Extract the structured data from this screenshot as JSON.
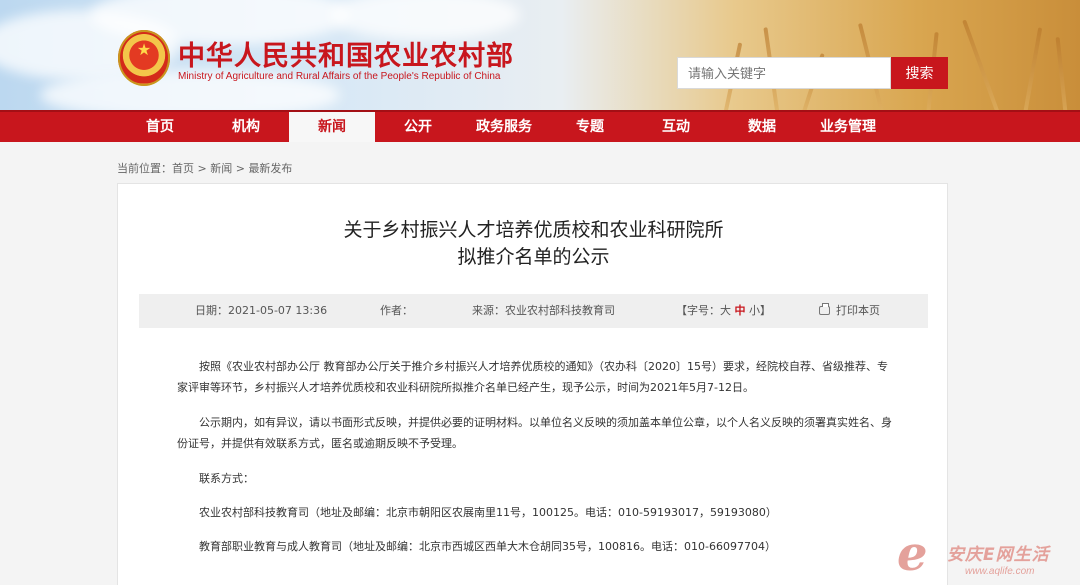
{
  "header": {
    "title": "中华人民共和国农业农村部",
    "subtitle": "Ministry of Agriculture and Rural Affairs of the People's Republic of China",
    "search_placeholder": "请输入关键字",
    "search_button": "搜索"
  },
  "nav": {
    "items": [
      "首页",
      "机构",
      "新闻",
      "公开",
      "政务服务",
      "专题",
      "互动",
      "数据",
      "业务管理"
    ],
    "active": "新闻"
  },
  "breadcrumb": {
    "label": "当前位置：",
    "items": [
      "首页",
      "新闻",
      "最新发布"
    ],
    "separator": ">"
  },
  "article": {
    "title_line1": "关于乡村振兴人才培养优质校和农业科研院所",
    "title_line2": "拟推介名单的公示",
    "meta": {
      "date": "日期：2021-05-07 13:36",
      "author": "作者：",
      "source": "来源：农业农村部科技教育司",
      "font_label": "【字号：",
      "font_large": "大",
      "font_medium": "中",
      "font_small": "小",
      "font_end": "】",
      "print": "打印本页"
    },
    "para1": "按照《农业农村部办公厅 教育部办公厅关于推介乡村振兴人才培养优质校的通知》（农办科〔2020〕15号）要求，经院校自荐、省级推荐、专家评审等环节，乡村振兴人才培养优质校和农业科研院所拟推介名单已经产生，现予公示，时间为2021年5月7-12日。",
    "para2": "公示期内，如有异议，请以书面形式反映，并提供必要的证明材料。以单位名义反映的须加盖本单位公章，以个人名义反映的须署真实姓名、身份证号，并提供有效联系方式，匿名或逾期反映不予受理。",
    "contact_label": "联系方式：",
    "contact1": "农业农村部科技教育司（地址及邮编：北京市朝阳区农展南里11号，100125。电话：010-59193017，59193080）",
    "contact2": "教育部职业教育与成人教育司（地址及邮编：北京市西城区西单大木仓胡同35号，100816。电话：010-66097704）"
  },
  "watermark": {
    "letter": "e",
    "name": "安庆E网生活",
    "url": "www.aqlife.com"
  },
  "colors": {
    "brand_red": "#c8161d",
    "meta_bg": "#efefef",
    "watermark": "#e4a19b"
  }
}
